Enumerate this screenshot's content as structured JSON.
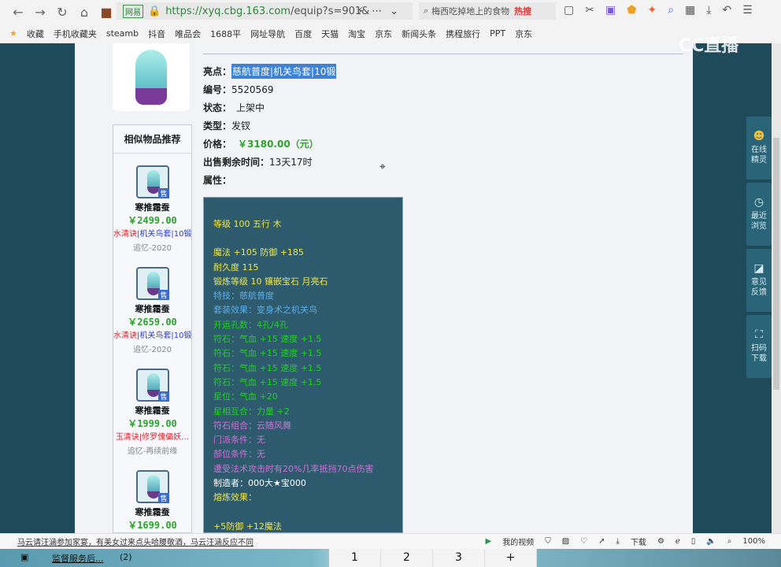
{
  "browser": {
    "site_label": "网易",
    "url_host": "https://xyq.cbg.163.com",
    "url_path": "/equip?s=901&",
    "search_text": "梅西吃掉地上的食物",
    "search_badge": "热搜",
    "bookmarks": [
      "收藏",
      "手机收藏夹",
      "steamb",
      "抖音",
      "唯品会",
      "1688平",
      "网址导航",
      "百度",
      "天猫",
      "淘宝",
      "京东",
      "新闻头条",
      "携程旅行",
      "PPT",
      "京东"
    ],
    "status_news": "马云请汪涵参加家宴，有美女过来点头哈腰敬酒，马云汪涵反应不同",
    "status_items": [
      "我的视频",
      "下载",
      "100%"
    ]
  },
  "overlay_logo": "CC直播",
  "details": {
    "highlight_label": "亮点：",
    "highlight": "慈航普度|机关鸟套|10锻",
    "id_label": "编号：",
    "id": "5520569",
    "state_label": "状态：",
    "state": "上架中",
    "type_label": "类型：",
    "type": "发钗",
    "price_label": "价格：",
    "price": "￥3180.00（元）",
    "time_label": "出售剩余时间：",
    "time": "13天17时",
    "attr_label": "属性："
  },
  "attributes": [
    {
      "c": "y",
      "t": "等级 100 五行 木"
    },
    {
      "c": "gap",
      "t": ""
    },
    {
      "c": "y",
      "t": "魔法 +105 防御 +185"
    },
    {
      "c": "y",
      "t": "耐久度 115"
    },
    {
      "c": "y",
      "t": "锻炼等级 10 镶嵌宝石 月亮石"
    },
    {
      "c": "bl",
      "t": "特技：慈航普度"
    },
    {
      "c": "bl",
      "t": "套装效果：变身术之机关鸟"
    },
    {
      "c": "g",
      "t": "开运孔数：4孔/4孔"
    },
    {
      "c": "g",
      "t": "符石：气血 +15 速度 +1.5"
    },
    {
      "c": "g",
      "t": "符石：气血 +15 速度 +1.5"
    },
    {
      "c": "g",
      "t": "符石：气血 +15 速度 +1.5"
    },
    {
      "c": "g",
      "t": "符石：气血 +15 速度 +1.5"
    },
    {
      "c": "g",
      "t": "星位：气血 +20"
    },
    {
      "c": "g",
      "t": "星相互合：力量 +2"
    },
    {
      "c": "p",
      "t": "符石组合：云随风舞"
    },
    {
      "c": "p",
      "t": "门派条件：无"
    },
    {
      "c": "p",
      "t": "部位条件：无"
    },
    {
      "c": "p",
      "t": "遭受法术攻击时有20%几率抵挡70点伤害"
    },
    {
      "c": "w",
      "t": "制造者：000大★宝000"
    },
    {
      "c": "y",
      "t": "熔炼效果："
    },
    {
      "c": "gap",
      "t": ""
    },
    {
      "c": "y",
      "t": "+5防御 +12魔法"
    }
  ],
  "similar": {
    "title": "相似物品推荐",
    "sale_badge": "售",
    "items": [
      {
        "name": "寒推霜蚕",
        "price": "￥2499.00",
        "tag_red": "水清诀",
        "tag_blue": "|机关鸟套|10锻",
        "server": "追忆-2020"
      },
      {
        "name": "寒推霜蚕",
        "price": "￥2659.00",
        "tag_red": "水清诀",
        "tag_blue": "|机关鸟套|10锻",
        "server": "追忆-2020"
      },
      {
        "name": "寒推霜蚕",
        "price": "￥1999.00",
        "tag_red": "玉清诀|修罗傀儡妖…",
        "tag_blue": "",
        "server": "追忆-再续前缘"
      },
      {
        "name": "寒推霜蚕",
        "price": "￥1699.00",
        "tag_red": "",
        "tag_blue": "",
        "server": ""
      }
    ]
  },
  "sidebar": [
    "在线精灵",
    "最近浏览",
    "意见反馈",
    "扫码下载"
  ],
  "taskbar": {
    "left": "监督服务后...",
    "count": "(2)",
    "pages": [
      "1",
      "2",
      "3",
      "+"
    ]
  }
}
